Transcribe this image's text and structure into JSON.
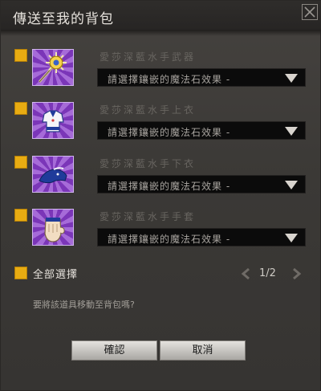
{
  "dialog": {
    "title": "傳送至我的背包",
    "close_icon": "close-icon"
  },
  "items": [
    {
      "name": "愛莎深藍水手武器",
      "select_value": "請選擇鑲嵌的魔法石效果 -",
      "checked": true,
      "icon": "weapon-staff-icon"
    },
    {
      "name": "愛莎深藍水手上衣",
      "select_value": "請選擇鑲嵌的魔法石效果 -",
      "checked": true,
      "icon": "sailor-top-icon"
    },
    {
      "name": "愛莎深藍水手下衣",
      "select_value": "請選擇鑲嵌的魔法石效果 -",
      "checked": true,
      "icon": "sailor-bottom-icon"
    },
    {
      "name": "愛莎深藍水手手套",
      "select_value": "請選擇鑲嵌的魔法石效果 -",
      "checked": true,
      "icon": "glove-icon"
    }
  ],
  "select_all": {
    "label": "全部選擇",
    "checked": true
  },
  "pager": {
    "text": "1/2"
  },
  "prompt": "要將該道具移動至背包嗎?",
  "buttons": {
    "confirm": "確認",
    "cancel": "取消"
  },
  "colors": {
    "accent": "#e8ac12",
    "background": "#3b3936",
    "titlebar": "#2b2928",
    "icon_bg": "#8e4fc6"
  }
}
